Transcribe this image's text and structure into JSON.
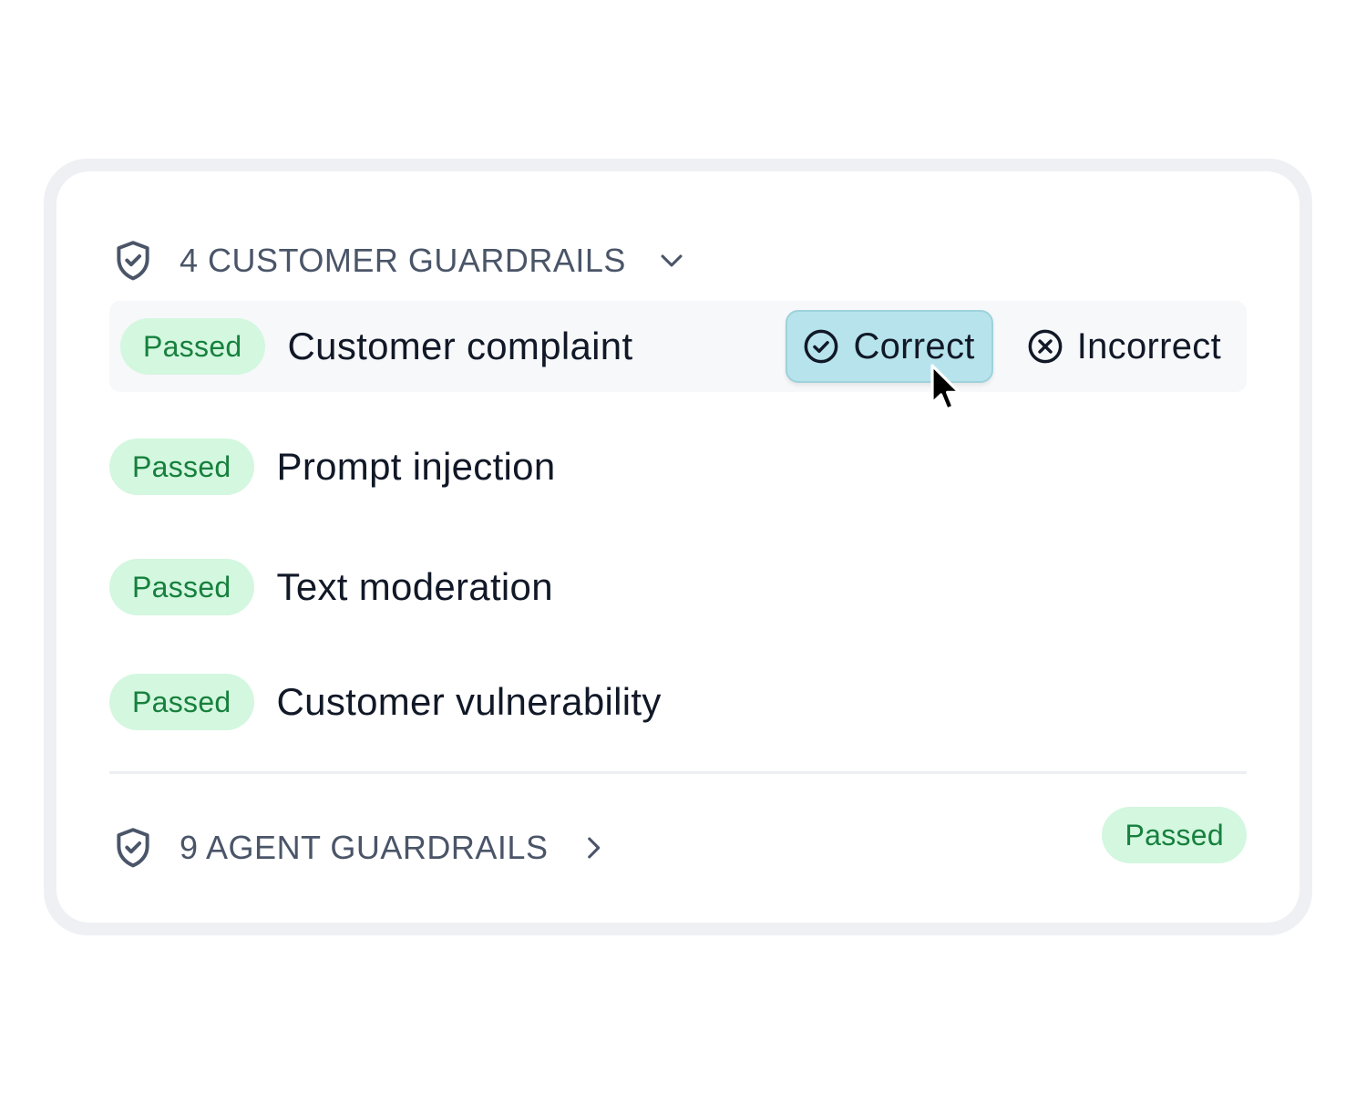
{
  "customer_guardrails": {
    "title": "4 CUSTOMER GUARDRAILS",
    "expanded_icon": "chevron-down-icon",
    "icon": "shield-check-icon",
    "rows": [
      {
        "status": "Passed",
        "label": "Customer complaint"
      },
      {
        "status": "Passed",
        "label": "Prompt injection"
      },
      {
        "status": "Passed",
        "label": "Text moderation"
      },
      {
        "status": "Passed",
        "label": "Customer vulnerability"
      }
    ],
    "actions": {
      "correct_label": "Correct",
      "correct_icon": "check-circle-icon",
      "incorrect_label": "Incorrect",
      "incorrect_icon": "x-circle-icon"
    }
  },
  "agent_guardrails": {
    "title": "9 AGENT GUARDRAILS",
    "collapsed_icon": "chevron-right-icon",
    "icon": "shield-check-icon",
    "status": "Passed"
  },
  "colors": {
    "badge_bg": "#d3f7df",
    "badge_text": "#17803d",
    "correct_bg": "#b7e4ec",
    "header_text": "#4a5568",
    "row_text": "#111827"
  }
}
